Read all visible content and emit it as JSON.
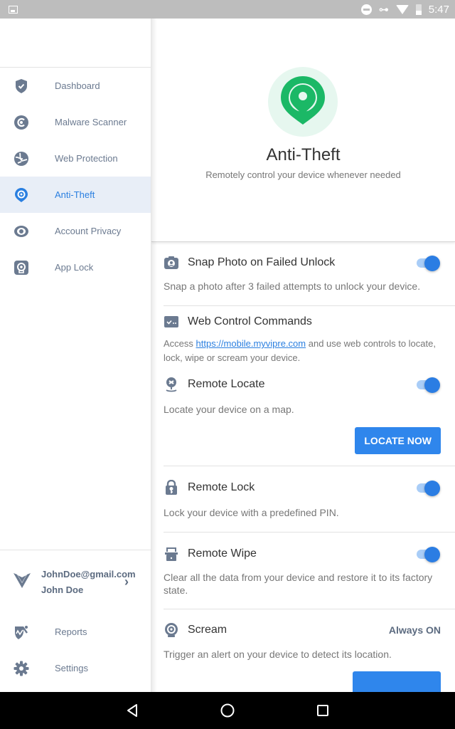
{
  "status_bar": {
    "time": "5:47",
    "icons": [
      "image-icon",
      "do-not-disturb-icon",
      "vpn-key-icon",
      "wifi-icon",
      "battery-icon"
    ]
  },
  "sidebar": {
    "items": [
      {
        "label": "Dashboard",
        "icon": "shield-check-icon",
        "active": false
      },
      {
        "label": "Malware Scanner",
        "icon": "scanner-icon",
        "active": false
      },
      {
        "label": "Web Protection",
        "icon": "globe-icon",
        "active": false
      },
      {
        "label": "Anti-Theft",
        "icon": "location-pin-icon",
        "active": true
      },
      {
        "label": "Account Privacy",
        "icon": "eye-icon",
        "active": false
      },
      {
        "label": "App Lock",
        "icon": "app-lock-icon",
        "active": false
      }
    ],
    "account": {
      "email": "JohnDoe@gmail.com",
      "name": "John Doe",
      "logo": "vipre-logo-icon"
    },
    "bottom_items": [
      {
        "label": "Reports",
        "icon": "reports-icon"
      },
      {
        "label": "Settings",
        "icon": "gear-icon"
      }
    ]
  },
  "main": {
    "hero": {
      "title": "Anti-Theft",
      "subtitle": "Remotely control your device whenever needed",
      "icon": "location-pin-icon"
    },
    "features": {
      "snap_photo": {
        "title": "Snap Photo on Failed Unlock",
        "description": "Snap a photo after 3 failed attempts to unlock your device.",
        "enabled": true
      },
      "web_control": {
        "title": "Web Control Commands",
        "desc_prefix": "Access ",
        "link": "https://mobile.myvipre.com",
        "desc_suffix": " and use web controls to locate, lock, wipe or scream your device."
      },
      "remote_locate": {
        "title": "Remote Locate",
        "description": "Locate your device on a map.",
        "enabled": true,
        "button": "LOCATE NOW"
      },
      "remote_lock": {
        "title": "Remote Lock",
        "description": "Lock your device with a predefined PIN.",
        "enabled": true
      },
      "remote_wipe": {
        "title": "Remote Wipe",
        "description": "Clear all the data from your device and restore it to its factory state.",
        "enabled": true
      },
      "scream": {
        "title": "Scream",
        "status": "Always ON",
        "description": "Trigger an alert on your device to detect its location."
      }
    }
  },
  "colors": {
    "accent": "#2f86ec",
    "toggle_track": "#a9cdf7",
    "hero_green": "#1bb866",
    "hero_bg": "#e6f7ef",
    "icon_slate": "#6b7a90",
    "active_bg": "#e8eef7",
    "status_bar": "#bdbdbd"
  }
}
